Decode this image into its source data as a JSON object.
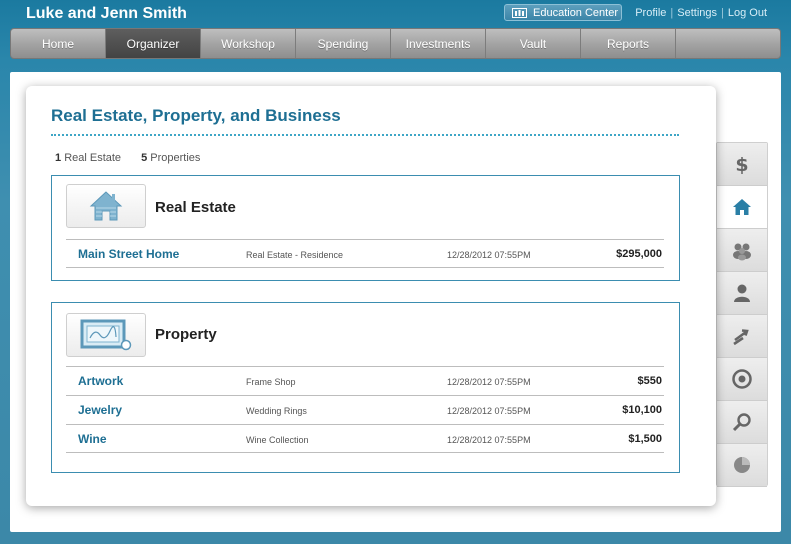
{
  "header": {
    "user_name": "Luke and Jenn Smith",
    "education_center": "Education Center",
    "links": [
      "Profile",
      "Settings",
      "Log Out"
    ]
  },
  "nav": {
    "items": [
      "Home",
      "Organizer",
      "Workshop",
      "Spending",
      "Investments",
      "Vault",
      "Reports"
    ],
    "active": "Organizer"
  },
  "page": {
    "title": "Real Estate, Property, and Business",
    "summary": [
      {
        "count": "1",
        "label": "Real Estate"
      },
      {
        "count": "5",
        "label": "Properties"
      }
    ]
  },
  "sections": {
    "real_estate": {
      "title": "Real Estate",
      "icon": "house-icon",
      "rows": [
        {
          "name": "Main Street Home",
          "desc": "Real Estate - Residence",
          "date": "12/28/2012   07:55PM",
          "amount": "$295,000"
        }
      ]
    },
    "property": {
      "title": "Property",
      "icon": "artwork-frame-icon",
      "rows": [
        {
          "name": "Artwork",
          "desc": "Frame Shop",
          "date": "12/28/2012   07:55PM",
          "amount": "$550"
        },
        {
          "name": "Jewelry",
          "desc": "Wedding Rings",
          "date": "12/28/2012   07:55PM",
          "amount": "$10,100"
        },
        {
          "name": "Wine",
          "desc": "Wine Collection",
          "date": "12/28/2012   07:55PM",
          "amount": "$1,500"
        }
      ]
    }
  },
  "side_tabs": [
    "dollar-icon",
    "house-icon",
    "people-icon",
    "person-icon",
    "arrows-icon",
    "target-icon",
    "magnifier-icon",
    "pie-chart-icon"
  ],
  "colors": {
    "accent": "#1e6f93",
    "border": "#3b8db0",
    "dotted_rule": "#3ea6c6"
  }
}
